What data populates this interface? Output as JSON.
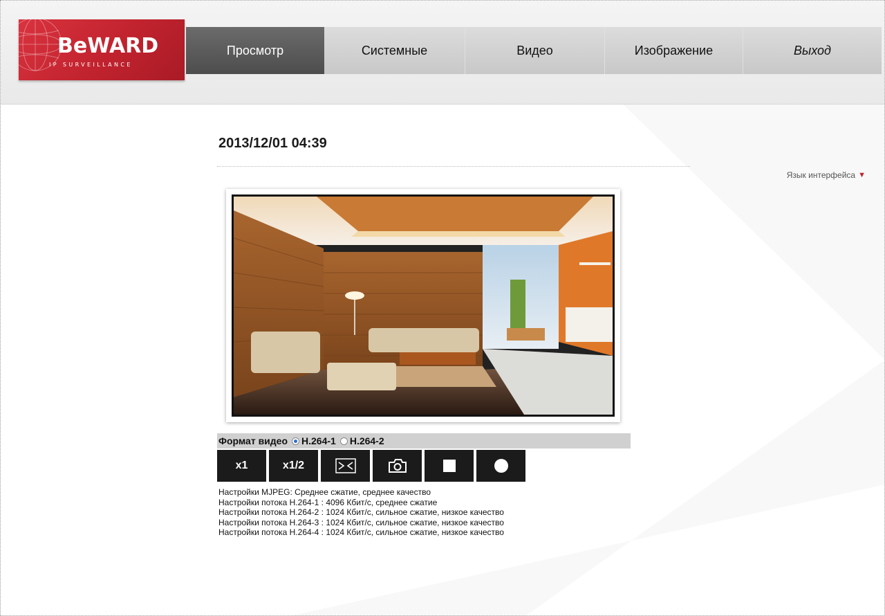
{
  "header": {
    "logo": {
      "word": "BeWARD",
      "tagline": "IP SURVEILLANCE"
    },
    "nav": [
      {
        "label": "Просмотр",
        "active": true
      },
      {
        "label": "Системные",
        "active": false
      },
      {
        "label": "Видео",
        "active": false
      },
      {
        "label": "Изображение",
        "active": false
      },
      {
        "label": "Выход",
        "active": false
      }
    ]
  },
  "main": {
    "datetime": "2013/12/01 04:39",
    "language_label": "Язык интерфейса",
    "format": {
      "label": "Формат видео",
      "options": [
        "H.264-1",
        "H.264-2"
      ],
      "selected": "H.264-1"
    },
    "controls": [
      {
        "label": "x1",
        "icon": ""
      },
      {
        "label": "x1/2",
        "icon": ""
      },
      {
        "label": "",
        "icon": "fit-window-icon"
      },
      {
        "label": "",
        "icon": "camera-icon"
      },
      {
        "label": "",
        "icon": "stop-icon"
      },
      {
        "label": "",
        "icon": "record-icon"
      }
    ],
    "stream_info": [
      "Настройки MJPEG: Среднее сжатие, среднее качество",
      "Настройки потока H.264-1 : 4096 Кбит/с, среднее сжатие",
      "Настройки потока H.264-2 : 1024 Кбит/с, сильное сжатие, низкое качество",
      "Настройки потока H.264-3 : 1024 Кбит/с, сильное сжатие, низкое качество",
      "Настройки потока H.264-4 : 1024 Кбит/с, сильное сжатие, низкое качество"
    ]
  },
  "colors": {
    "brand_red": "#c1232e",
    "nav_active": "#555555",
    "control_bg": "#1b1b1b",
    "radio_on": "#2d6fd2"
  }
}
